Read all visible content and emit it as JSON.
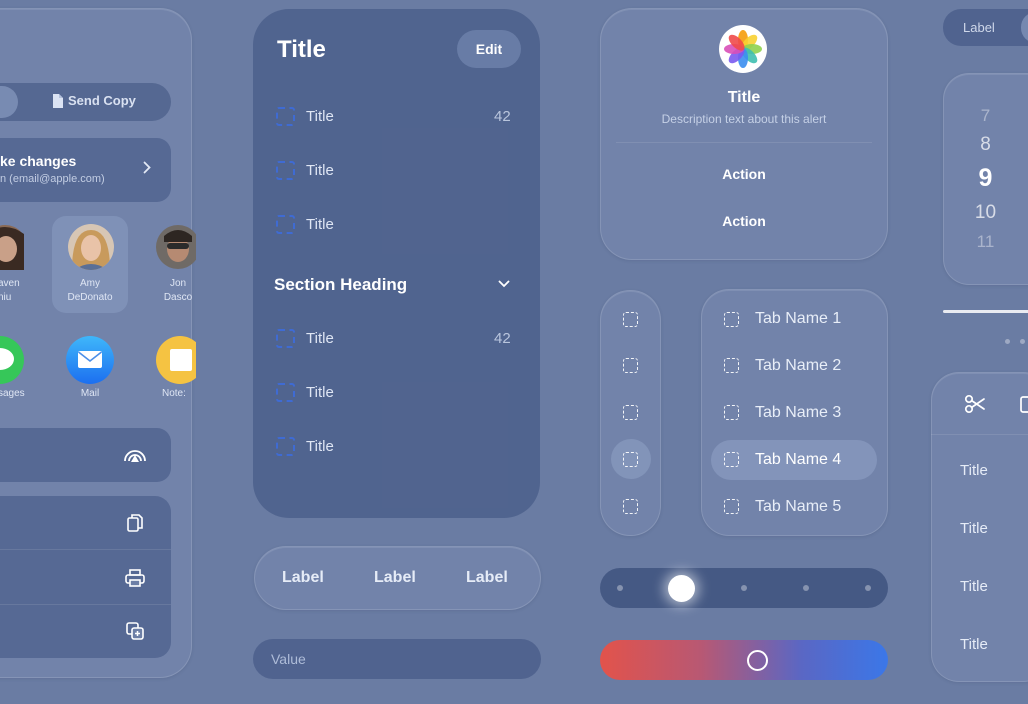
{
  "share_sheet": {
    "send_copy_label": "Send Copy",
    "make_changes_title": "ke changes",
    "make_changes_subtitle": "n (email@apple.com)",
    "people": [
      {
        "name_line1": "aven",
        "name_line2": "niu"
      },
      {
        "name_line1": "Amy",
        "name_line2": "DeDonato"
      },
      {
        "name_line1": "Jon",
        "name_line2": "Dasco"
      }
    ],
    "apps": [
      {
        "label": "sages",
        "icon": "messages-icon"
      },
      {
        "label": "Mail",
        "icon": "mail-icon"
      },
      {
        "label": "Note:",
        "icon": "notes-icon"
      }
    ]
  },
  "list_panel": {
    "title": "Title",
    "edit_label": "Edit",
    "rows_top": [
      {
        "label": "Title",
        "count": "42"
      },
      {
        "label": "Title",
        "count": ""
      },
      {
        "label": "Title",
        "count": ""
      }
    ],
    "section_heading": "Section Heading",
    "rows_bottom": [
      {
        "label": "Title",
        "count": "42"
      },
      {
        "label": "Title",
        "count": ""
      },
      {
        "label": "Title",
        "count": ""
      }
    ]
  },
  "segmented": {
    "labels": [
      "Label",
      "Label",
      "Label"
    ]
  },
  "value_field": {
    "placeholder": "Value"
  },
  "alert": {
    "title": "Title",
    "description": "Description text about this alert",
    "actions": [
      "Action",
      "Action"
    ]
  },
  "tabs": {
    "items": [
      "Tab Name 1",
      "Tab Name 2",
      "Tab Name 3",
      "Tab Name 4",
      "Tab Name 5"
    ],
    "selected_index": 3
  },
  "page_control": {
    "pages": 5,
    "current": 1
  },
  "gradient_slider": {
    "from": "#e2534b",
    "to": "#3b77e8",
    "value": 0.55
  },
  "right_column": {
    "toggle_label": "Label",
    "picker": [
      "7",
      "8",
      "9",
      "10",
      "11"
    ],
    "picker_selected": "9",
    "menu_items": [
      "Title",
      "Title",
      "Title",
      "Title"
    ]
  },
  "colors": {
    "background": "#6a7ca3",
    "accent_blue": "#3f6bd3"
  }
}
